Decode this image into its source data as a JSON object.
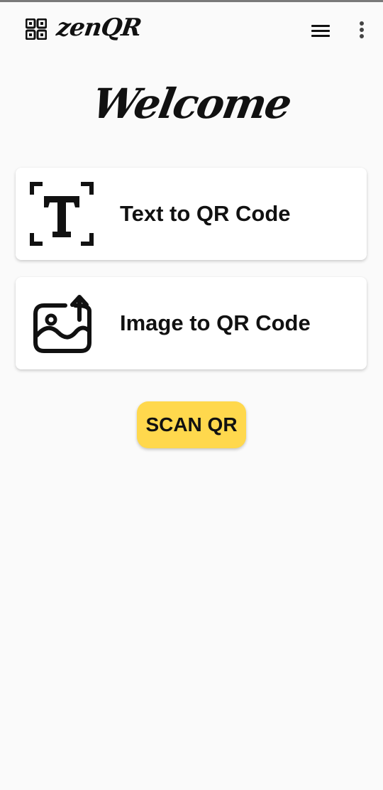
{
  "app_bar": {
    "brand": "zenQR",
    "icons": {
      "logo": "qr-code-icon",
      "menu": "hamburger-menu-icon",
      "more": "more-vertical-icon"
    }
  },
  "main": {
    "heading": "Welcome",
    "options": [
      {
        "label": "Text to QR Code",
        "icon": "text-recognition-icon"
      },
      {
        "label": "Image to QR Code",
        "icon": "image-upload-icon"
      }
    ],
    "scan_button_label": "SCAN QR"
  },
  "colors": {
    "background": "#fafafa",
    "card": "#ffffff",
    "accent": "#ffd84d",
    "text": "#111111"
  }
}
